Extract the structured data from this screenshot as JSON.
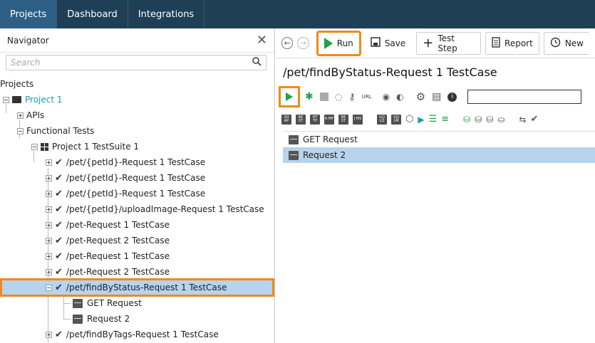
{
  "topbar": {
    "tabs": [
      {
        "label": "Projects",
        "active": true
      },
      {
        "label": "Dashboard",
        "active": false
      },
      {
        "label": "Integrations",
        "active": false
      }
    ]
  },
  "navigator": {
    "title": "Navigator",
    "search_placeholder": "Search",
    "tree": [
      {
        "label": "Projects"
      },
      {
        "label": "Project 1"
      },
      {
        "label": "APIs"
      },
      {
        "label": "Functional Tests"
      },
      {
        "label": "Project 1 TestSuite 1"
      },
      {
        "label": "/pet/{petId}-Request 1 TestCase"
      },
      {
        "label": "/pet/{petId}-Request 1 TestCase"
      },
      {
        "label": "/pet/{petId}-Request 1 TestCase"
      },
      {
        "label": "/pet/{petId}/uploadImage-Request 1 TestCase"
      },
      {
        "label": "/pet-Request 1 TestCase"
      },
      {
        "label": "/pet-Request 2 TestCase"
      },
      {
        "label": "/pet-Request 1 TestCase"
      },
      {
        "label": "/pet-Request 2 TestCase"
      },
      {
        "label": "/pet/findByStatus-Request 1 TestCase"
      },
      {
        "label": "GET Request"
      },
      {
        "label": "Request 2"
      },
      {
        "label": "/pet/findByTags-Request 1 TestCase"
      }
    ]
  },
  "editor": {
    "toolbar": {
      "run_label": "Run",
      "save_label": "Save",
      "test_step_label": "Test Step",
      "report_label": "Report",
      "new_label": "New"
    },
    "title": "/pet/findByStatus-Request 1 TestCase",
    "url_label": "URL",
    "step_icons": [
      "SO AP",
      "RE ST",
      "HT TP",
      "A MF",
      "RE ST",
      "J MS",
      "GQ LQ",
      "GQ LM"
    ],
    "steps": [
      {
        "label": "GET Request",
        "selected": false
      },
      {
        "label": "Request 2",
        "selected": true
      }
    ]
  },
  "colors": {
    "topbar": "#1f3f57",
    "active_tab": "#2d5f86",
    "highlight": "#ef8a1b",
    "selection": "#b8d3eb",
    "run_green": "#22a047",
    "project_link": "#1a9bb0"
  }
}
